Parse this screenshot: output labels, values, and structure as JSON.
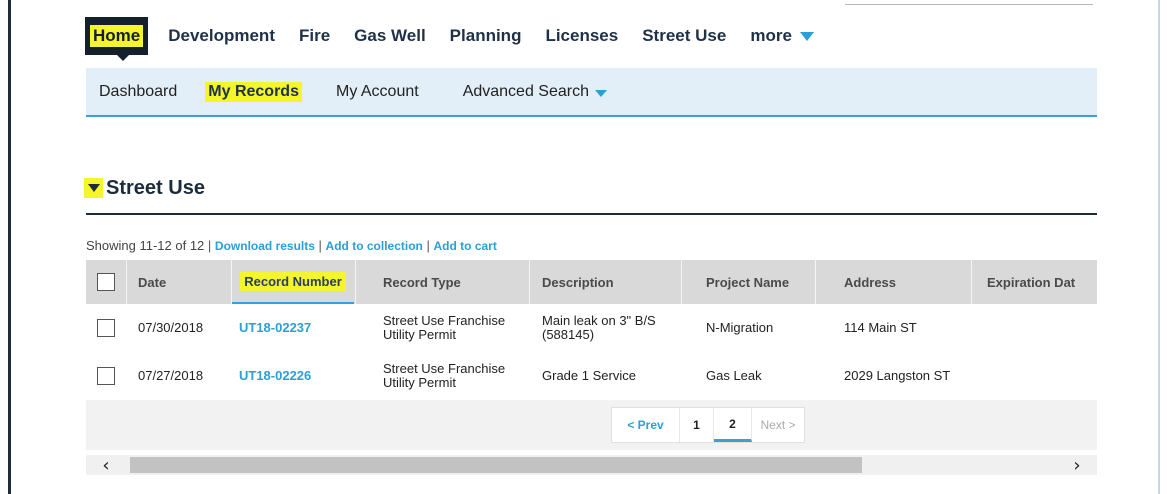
{
  "top_nav": {
    "items": [
      "Home",
      "Development",
      "Fire",
      "Gas Well",
      "Planning",
      "Licenses",
      "Street Use",
      "more"
    ]
  },
  "sub_nav": {
    "items": [
      "Dashboard",
      "My Records",
      "My Account",
      "Advanced Search"
    ]
  },
  "section": {
    "title": "Street Use"
  },
  "results": {
    "showing": "Showing 11-12 of 12",
    "links": [
      "Download results",
      "Add to collection",
      "Add to cart"
    ]
  },
  "table": {
    "columns": [
      "Date",
      "Record Number",
      "Record Type",
      "Description",
      "Project Name",
      "Address",
      "Expiration Dat"
    ],
    "rows": [
      {
        "date": "07/30/2018",
        "record_number": "UT18-02237",
        "record_type": [
          "Street Use Franchise",
          "Utility Permit"
        ],
        "description": [
          "Main leak on 3\" B/S",
          "(588145)"
        ],
        "project_name": "N-Migration",
        "address": "114 Main ST",
        "expiration_date": ""
      },
      {
        "date": "07/27/2018",
        "record_number": "UT18-02226",
        "record_type": [
          "Street Use Franchise",
          "Utility Permit"
        ],
        "description": [
          "Grade 1 Service",
          ""
        ],
        "project_name": "Gas Leak",
        "address": "2029 Langston ST",
        "expiration_date": ""
      }
    ]
  },
  "pagination": {
    "prev": "< Prev",
    "pages": [
      "1",
      "2"
    ],
    "current": "2",
    "next": "Next >"
  },
  "scrollbar": {
    "left": "‹",
    "right": "›"
  },
  "colors": {
    "highlight": "#f4f52a",
    "navy": "#1d2b3c",
    "link_blue": "#2a9fd8",
    "subnav_bg": "#e2eef8"
  }
}
